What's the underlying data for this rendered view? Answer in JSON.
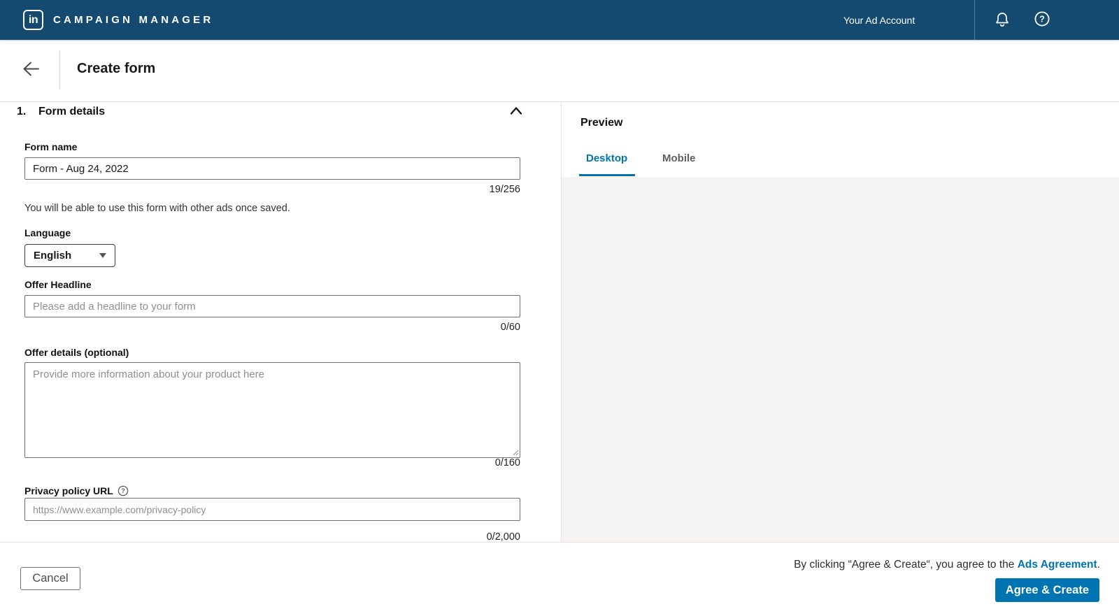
{
  "nav": {
    "logo_text": "in",
    "brand": "CAMPAIGN MANAGER",
    "account_label": "Your Ad Account"
  },
  "header": {
    "title": "Create form"
  },
  "form": {
    "section_number": "1.",
    "section_title": "Form details",
    "form_name": {
      "label": "Form name",
      "value": "Form - Aug 24, 2022",
      "counter": "19/256"
    },
    "note": "You will be able to use this form with other ads once saved.",
    "language": {
      "label": "Language",
      "value": "English"
    },
    "offer_headline": {
      "label": "Offer Headline",
      "placeholder": "Please add a headline to your form",
      "counter": "0/60"
    },
    "offer_details": {
      "label": "Offer details (optional)",
      "placeholder": "Provide more information about your product here",
      "counter": "0/160"
    },
    "privacy_url": {
      "label": "Privacy policy URL",
      "placeholder": "https://www.example.com/privacy-policy",
      "counter": "0/2,000"
    }
  },
  "preview": {
    "title": "Preview",
    "tabs": [
      {
        "label": "Desktop",
        "active": true
      },
      {
        "label": "Mobile",
        "active": false
      }
    ]
  },
  "footer": {
    "cancel_label": "Cancel",
    "agreement_prefix": "By clicking “Agree & Create“, you agree to the ",
    "agreement_link_label": "Ads Agreement",
    "agreement_suffix": ".",
    "submit_label": "Agree & Create"
  },
  "icons": {
    "help_glyph": "?"
  },
  "colors": {
    "nav_bg": "#144a70",
    "accent_blue": "#0073b1",
    "preview_bg": "#f4f3f1"
  }
}
